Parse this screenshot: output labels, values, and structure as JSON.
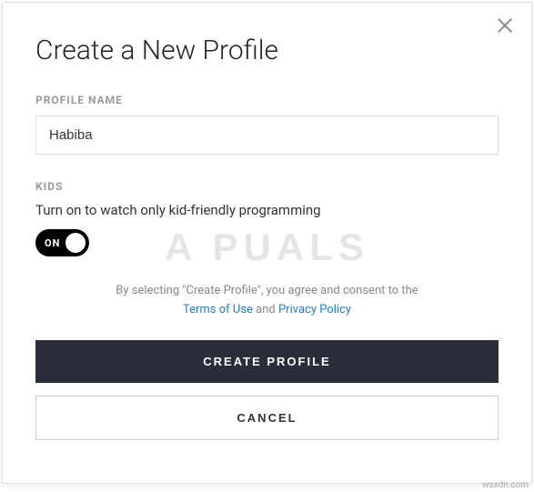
{
  "modal": {
    "title": "Create a New Profile",
    "profileName": {
      "label": "PROFILE NAME",
      "value": "Habiba"
    },
    "kids": {
      "label": "KIDS",
      "description": "Turn on to watch only kid-friendly programming",
      "toggleLabel": "ON"
    },
    "consent": {
      "prefix": "By selecting \"Create Profile\", you agree and consent to the",
      "termsText": "Terms of Use",
      "and": " and ",
      "privacyText": "Privacy Policy"
    },
    "buttons": {
      "create": "CREATE PROFILE",
      "cancel": "CANCEL"
    }
  },
  "watermark": {
    "brand": "A  PUALS",
    "source": "wsxdn.com"
  }
}
